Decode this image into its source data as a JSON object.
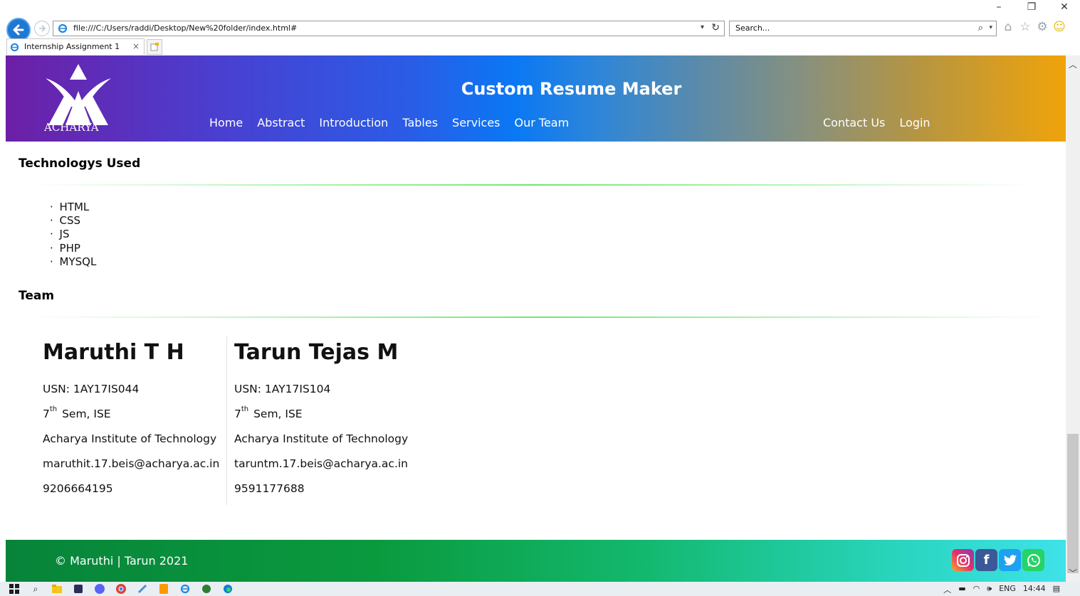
{
  "browser": {
    "url": "file:///C:/Users/raddi/Desktop/New%20folder/index.html#",
    "search_placeholder": "Search...",
    "tab_title": "Internship Assignment 1",
    "window_controls": [
      "minimize-icon",
      "restore-icon",
      "close-icon"
    ],
    "toolbar_icons": [
      "home-icon",
      "favorites-star-icon",
      "settings-gear-icon",
      "smiley-feedback-icon"
    ]
  },
  "header": {
    "logo_text": "ACHARYA",
    "title": "Custom Resume Maker",
    "nav_left": [
      "Home",
      "Abstract",
      "Introduction",
      "Tables",
      "Services",
      "Our Team"
    ],
    "nav_right": [
      "Contact Us",
      "Login"
    ]
  },
  "technologies": {
    "heading": "Technologys Used",
    "items": [
      "HTML",
      "CSS",
      "JS",
      "PHP",
      "MYSQL"
    ]
  },
  "team": {
    "heading": "Team",
    "members": [
      {
        "name": "Maruthi T H",
        "usn": "USN: 1AY17IS044",
        "sem_num": "7",
        "sem_sup": "th",
        "sem_rest": " Sem, ISE",
        "college": "Acharya Institute of Technology",
        "email": "maruthit.17.beis@acharya.ac.in",
        "phone": "9206664195"
      },
      {
        "name": "Tarun Tejas M",
        "usn": "USN: 1AY17IS104",
        "sem_num": "7",
        "sem_sup": "th",
        "sem_rest": " Sem, ISE",
        "college": "Acharya Institute of Technology",
        "email": "taruntm.17.beis@acharya.ac.in",
        "phone": "9591177688"
      }
    ]
  },
  "footer": {
    "copyright": "© Maruthi | Tarun 2021",
    "social": [
      "instagram-icon",
      "facebook-icon",
      "twitter-icon",
      "whatsapp-icon"
    ]
  },
  "taskbar": {
    "lang": "ENG",
    "time": "14:44"
  },
  "colors": {
    "header_gradient_start": "#6d1fa6",
    "header_gradient_mid": "#0a78f4",
    "header_gradient_end": "#f0a30a",
    "footer_gradient_start": "#07843a",
    "footer_gradient_end": "#3fe2e8",
    "divider": "#6ee86e"
  }
}
